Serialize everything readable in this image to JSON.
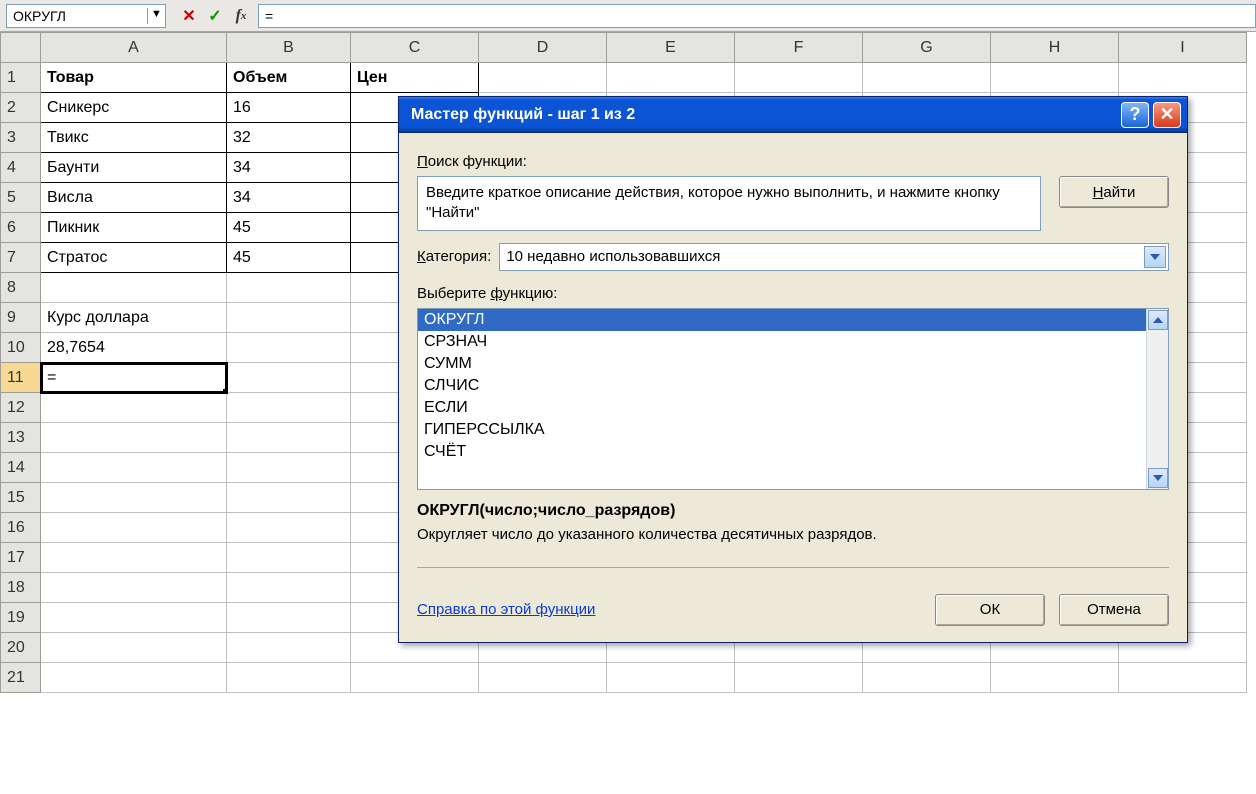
{
  "formula_bar": {
    "name_box": "ОКРУГЛ",
    "formula": "="
  },
  "columns": [
    "A",
    "B",
    "C",
    "D",
    "E",
    "F",
    "G",
    "H",
    "I"
  ],
  "rows": [
    {
      "n": 1,
      "A": "Товар",
      "B": "Объем",
      "C": "Цен",
      "bold": true,
      "bordered": true
    },
    {
      "n": 2,
      "A": "Сникерс",
      "B": "16",
      "bordered": true
    },
    {
      "n": 3,
      "A": "Твикс",
      "B": "32",
      "bordered": true
    },
    {
      "n": 4,
      "A": "Баунти",
      "B": "34",
      "bordered": true
    },
    {
      "n": 5,
      "A": "Висла",
      "B": "34",
      "bordered": true
    },
    {
      "n": 6,
      "A": "Пикник",
      "B": "45",
      "bordered": true
    },
    {
      "n": 7,
      "A": "Стратос",
      "B": "45",
      "bordered": true
    },
    {
      "n": 8,
      "A": "",
      "B": ""
    },
    {
      "n": 9,
      "A": "Курс доллара",
      "B": ""
    },
    {
      "n": 10,
      "A": "28,7654",
      "B": "",
      "A_right": true
    },
    {
      "n": 11,
      "A": "=",
      "B": "",
      "active": true
    },
    {
      "n": 12
    },
    {
      "n": 13
    },
    {
      "n": 14
    },
    {
      "n": 15
    },
    {
      "n": 16
    },
    {
      "n": 17
    },
    {
      "n": 18
    },
    {
      "n": 19
    },
    {
      "n": 20
    },
    {
      "n": 21
    }
  ],
  "dialog": {
    "title": "Мастер функций - шаг 1 из 2",
    "search_label_pre": "П",
    "search_label_rest": "оиск функции:",
    "search_text": "Введите краткое описание действия, которое нужно выполнить, и нажмите кнопку \"Найти\"",
    "find_btn_pre": "Н",
    "find_btn_rest": "айти",
    "category_label_pre": "К",
    "category_label_rest": "атегория:",
    "category_value": "10 недавно использовавшихся",
    "select_func_label_pre": "ф",
    "select_func_label_before": "Выберите ",
    "select_func_label_after": "ункцию:",
    "functions": [
      "ОКРУГЛ",
      "СРЗНАЧ",
      "СУММ",
      "СЛЧИС",
      "ЕСЛИ",
      "ГИПЕРССЫЛКА",
      "СЧЁТ"
    ],
    "selected_function_index": 0,
    "signature": "ОКРУГЛ(число;число_разрядов)",
    "description": "Округляет число до указанного количества десятичных разрядов.",
    "help_link": "Справка по этой функции",
    "ok": "ОК",
    "cancel": "Отмена"
  }
}
